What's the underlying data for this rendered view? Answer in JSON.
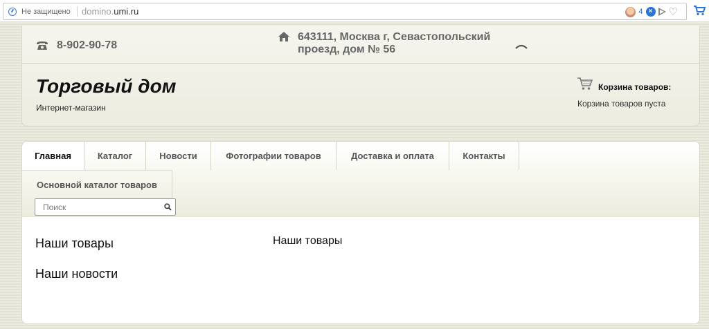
{
  "browser": {
    "security_label": "Не защищено",
    "url_prefix": "domino.",
    "url_host": "umi.ru",
    "notification_count": "4",
    "badge_symbol": "×"
  },
  "header": {
    "phone": "8-902-90-78",
    "address": "643111, Москва г, Севастопольский проезд, дом № 56",
    "site_title": "Торговый дом",
    "site_subtitle": "Интернет-магазин",
    "cart_title": "Корзина товаров:",
    "cart_status": "Корзина товаров пуста"
  },
  "nav": {
    "tabs": [
      {
        "label": "Главная",
        "active": true
      },
      {
        "label": "Каталог"
      },
      {
        "label": "Новости"
      },
      {
        "label": "Фотографии товаров"
      },
      {
        "label": "Доставка и оплата"
      },
      {
        "label": "Контакты"
      }
    ],
    "row2_tab": "Основной каталог товаров",
    "search_placeholder": "Поиск"
  },
  "content": {
    "side_links": [
      "Наши товары",
      "Наши новости"
    ],
    "heading": "Наши товары"
  },
  "colors": {
    "accent": "#2a73d9",
    "text": "#111111",
    "muted": "#666666",
    "page_bg": "#e9e9dd"
  },
  "icons": [
    "insecure-icon",
    "baby-icon",
    "close-badge-icon",
    "send-icon",
    "heart-icon",
    "cart-icon",
    "phone-icon",
    "home-icon",
    "chevron-up-icon",
    "search-icon"
  ]
}
